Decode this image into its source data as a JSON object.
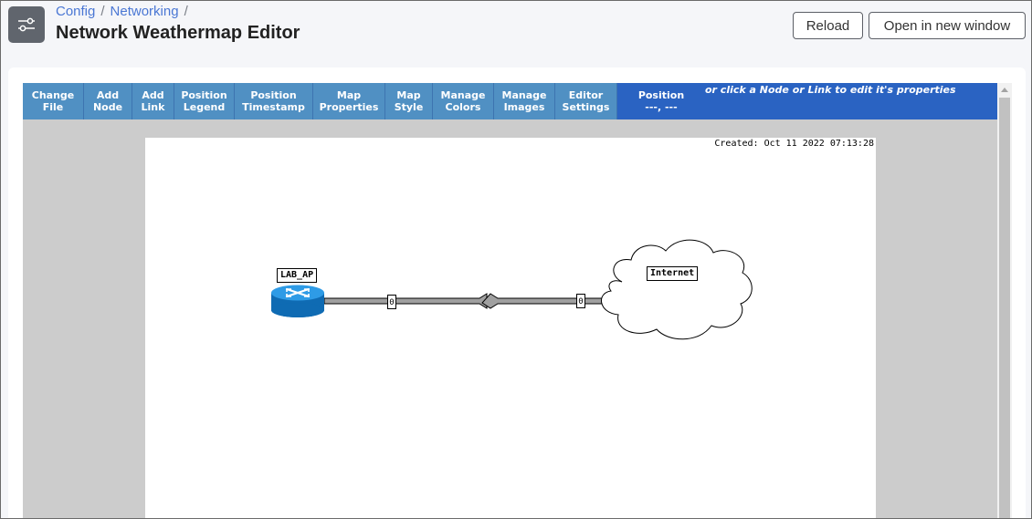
{
  "breadcrumb": {
    "items": [
      "Config",
      "Networking"
    ],
    "sep": "/"
  },
  "page": {
    "title": "Network Weathermap Editor"
  },
  "header_buttons": {
    "reload": "Reload",
    "open_new_window": "Open in new window"
  },
  "toolbar": {
    "buttons": [
      "Change\nFile",
      "Add\nNode",
      "Add\nLink",
      "Position\nLegend",
      "Position\nTimestamp",
      "Map\nProperties",
      "Map\nStyle",
      "Manage\nColors",
      "Manage\nImages",
      "Editor\nSettings"
    ],
    "position_label": "Position",
    "position_value": "---, ---",
    "hint": "or click a Node or Link to edit it's properties"
  },
  "map": {
    "created": "Created: Oct 11 2022 07:13:28",
    "nodes": [
      {
        "label": "LAB_AP",
        "icon": "router-icon"
      },
      {
        "label": "Internet",
        "icon": "cloud-icon"
      }
    ],
    "link": {
      "bw_in": "0",
      "bw_out": "0"
    }
  },
  "colors": {
    "accent": "#4a77d4",
    "toolbar_bg": "#2a63c2",
    "toolbar_btn": "#5090c3",
    "router": "#1f8ad6"
  }
}
